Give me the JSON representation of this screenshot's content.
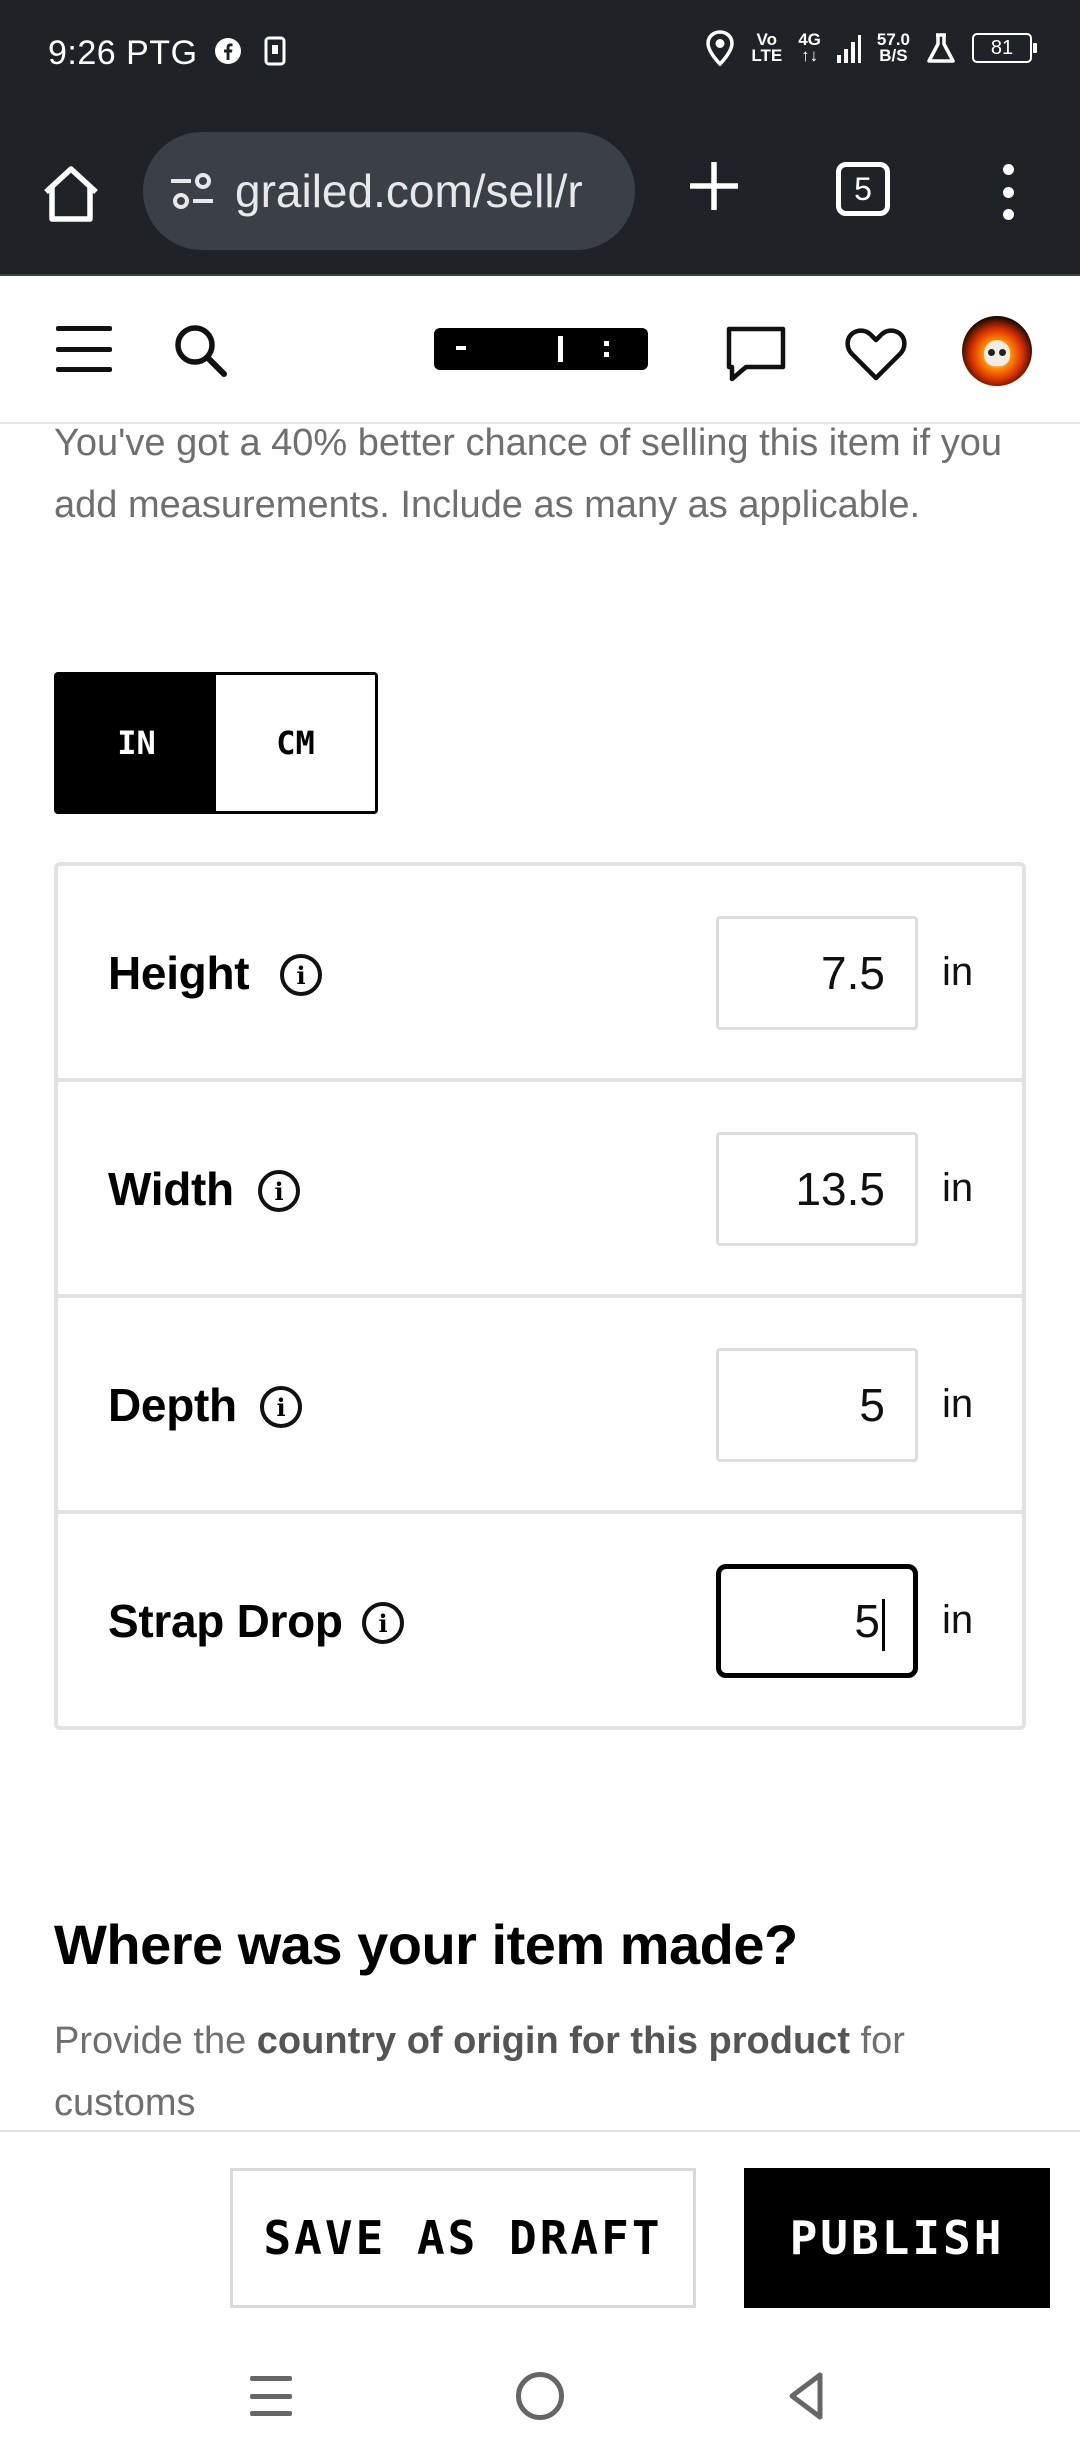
{
  "status_bar": {
    "time": "9:26 PTG",
    "network_top": "Vo",
    "network_bottom": "LTE",
    "signal_label_top": "4G",
    "signal_label_bottom": "↑↓",
    "speed_value": "57.0",
    "speed_unit": "B/S",
    "battery": "81"
  },
  "browser": {
    "url": "grailed.com/sell/r",
    "tab_count": "5"
  },
  "content": {
    "intro_text": "You've got a 40% better chance of selling this item if you add measurements. Include as many as applicable.",
    "unit_toggle": {
      "in_label": "IN",
      "cm_label": "CM",
      "selected": "IN"
    },
    "measurements": [
      {
        "label": "Height",
        "value": "7.5",
        "unit": "in"
      },
      {
        "label": "Width",
        "value": "13.5",
        "unit": "in"
      },
      {
        "label": "Depth",
        "value": "5",
        "unit": "in"
      },
      {
        "label": "Strap Drop",
        "value": "5",
        "unit": "in"
      }
    ],
    "origin_title": "Where was your item made?",
    "origin_desc_pre": "Provide the ",
    "origin_desc_bold": "country of origin for this product",
    "origin_desc_post": " for customs"
  },
  "actions": {
    "save_draft_label": "SAVE AS DRAFT",
    "publish_label": "PUBLISH"
  },
  "icons": {
    "home": "home-icon",
    "site_settings": "tune-icon",
    "new_tab": "plus-icon",
    "menu": "more-vert-icon",
    "hamburger": "menu-icon",
    "search": "search-icon",
    "messages": "chat-bubble-icon",
    "favorites": "heart-icon",
    "info": "info-icon"
  },
  "colors": {
    "chrome_bg": "#1f2328",
    "primary": "#000000",
    "muted_text": "#6f6f6f",
    "border": "#e2e2e2"
  }
}
